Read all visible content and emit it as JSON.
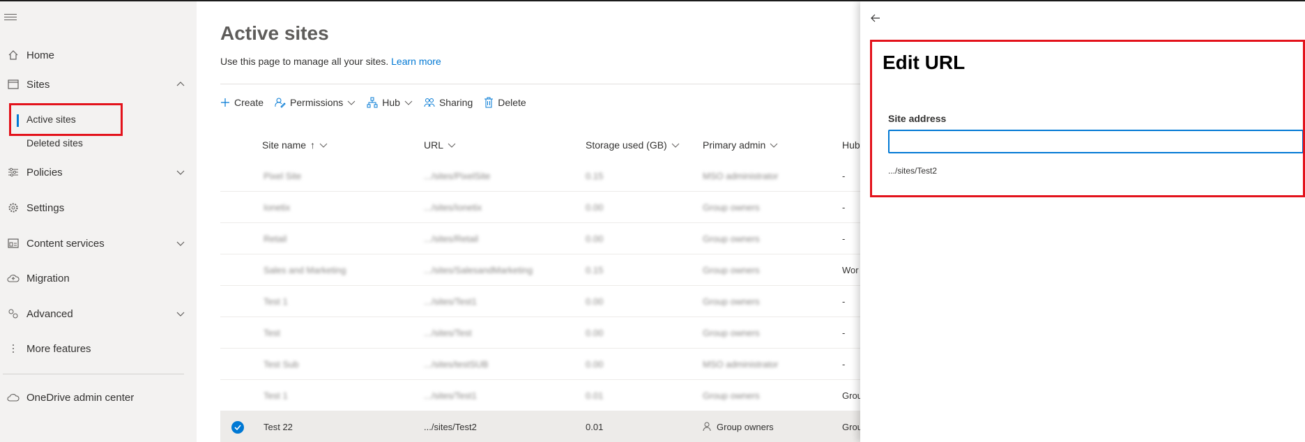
{
  "nav": {
    "items": [
      {
        "label": "Home",
        "icon": "home-icon"
      },
      {
        "label": "Sites",
        "icon": "sites-icon",
        "expanded": true
      },
      {
        "label": "Policies",
        "icon": "policies-icon"
      },
      {
        "label": "Settings",
        "icon": "settings-icon"
      },
      {
        "label": "Content services",
        "icon": "content-services-icon"
      },
      {
        "label": "Migration",
        "icon": "migration-icon"
      },
      {
        "label": "Advanced",
        "icon": "advanced-icon"
      },
      {
        "label": "More features",
        "icon": "more-features-icon"
      },
      {
        "label": "OneDrive admin center",
        "icon": "onedrive-icon"
      }
    ],
    "sites_sub": {
      "active": "Active sites",
      "deleted": "Deleted sites"
    }
  },
  "page": {
    "title": "Active sites",
    "description": "Use this page to manage all your sites.",
    "learn_more": "Learn more"
  },
  "toolbar": {
    "create": "Create",
    "permissions": "Permissions",
    "hub": "Hub",
    "sharing": "Sharing",
    "delete": "Delete"
  },
  "table": {
    "headers": {
      "site_name": "Site name",
      "url": "URL",
      "storage": "Storage used (GB)",
      "primary_admin": "Primary admin",
      "hub": "Hub"
    },
    "rows": [
      {
        "name": "Pixel Site",
        "url": ".../sites/PixelSite",
        "storage": "0.15",
        "admin": "MSO administrator",
        "hub": "-"
      },
      {
        "name": "Ionetix",
        "url": ".../sites/Ionetix",
        "storage": "0.00",
        "admin": "Group owners",
        "hub": "-"
      },
      {
        "name": "Retail",
        "url": ".../sites/Retail",
        "storage": "0.00",
        "admin": "Group owners",
        "hub": "-"
      },
      {
        "name": "Sales and Marketing",
        "url": ".../sites/SalesandMarketing",
        "storage": "0.15",
        "admin": "Group owners",
        "hub": "Wor"
      },
      {
        "name": "Test 1",
        "url": ".../sites/Test1",
        "storage": "0.00",
        "admin": "Group owners",
        "hub": "-"
      },
      {
        "name": "Test",
        "url": ".../sites/Test",
        "storage": "0.00",
        "admin": "Group owners",
        "hub": "-"
      },
      {
        "name": "Test Sub",
        "url": ".../sites/testSUB",
        "storage": "0.00",
        "admin": "MSO administrator",
        "hub": "-"
      },
      {
        "name": "Test 1",
        "url": ".../sites/Test1",
        "storage": "0.01",
        "admin": "Group owners",
        "hub": "Grou"
      },
      {
        "name": "Test 22",
        "url": ".../sites/Test2",
        "storage": "0.01",
        "admin": "Group owners",
        "hub": "Grou",
        "selected": true
      }
    ]
  },
  "panel": {
    "title": "Edit URL",
    "field_label": "Site address",
    "field_value": "",
    "hint": ".../sites/Test2"
  },
  "colors": {
    "accent": "#0078d4",
    "highlight": "#e3121b"
  }
}
